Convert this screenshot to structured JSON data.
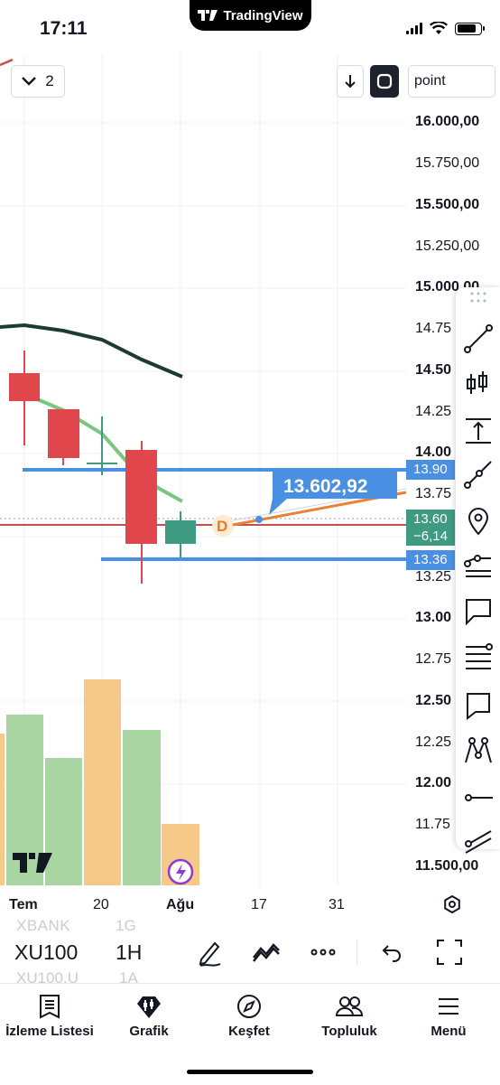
{
  "status": {
    "time": "17:11",
    "app_pill": "TradingView"
  },
  "chart_controls": {
    "collapse_count": "2",
    "unit_value": "point"
  },
  "price_axis": {
    "labels": [
      "16.000,00",
      "15.750,00",
      "15.500,00",
      "15.250,00",
      "15.000,00",
      "14.75",
      "14.50",
      "14.25",
      "14.00",
      "13.75",
      "13.25",
      "13.00",
      "12.75",
      "12.50",
      "12.25",
      "12.00",
      "11.75",
      "11.500,00"
    ],
    "tags": {
      "upper": "13.90",
      "current": "13.60",
      "change": "−6,14",
      "lower": "13.36"
    },
    "colors": {
      "upper": "#4a90e2",
      "current": "#3f9a82",
      "lower": "#4a90e2"
    }
  },
  "chart_overlay": {
    "price_callout": "13.602,92",
    "dividend_marker": "D",
    "candles": [
      {
        "open": 14.46,
        "high": 14.62,
        "low": 14.0,
        "close": 14.29,
        "direction": "down"
      },
      {
        "open": 14.26,
        "high": 14.26,
        "low": 13.95,
        "close": 13.98,
        "direction": "down"
      },
      {
        "open": 14.18,
        "high": 14.22,
        "low": 13.87,
        "close": 13.92,
        "direction": "neutral"
      },
      {
        "open": 14.02,
        "high": 14.07,
        "low": 13.21,
        "close": 13.45,
        "direction": "down"
      },
      {
        "open": 13.45,
        "high": 13.63,
        "low": 13.34,
        "close": 13.59,
        "direction": "up"
      }
    ],
    "volume_bars": [
      {
        "color": "orange"
      },
      {
        "color": "green"
      },
      {
        "color": "green"
      },
      {
        "color": "orange"
      },
      {
        "color": "green"
      },
      {
        "color": "orange"
      }
    ]
  },
  "time_axis": {
    "labels": [
      "Tem",
      "20",
      "Ağu",
      "17",
      "31"
    ]
  },
  "symbol_bar": {
    "symbol": "XU100",
    "interval": "1H",
    "ghost_above_symbol": "XBANK",
    "ghost_above_interval": "1G",
    "ghost_below_symbol": "XU100.U",
    "ghost_below_interval": "1A"
  },
  "bottom_nav": [
    {
      "label": "İzleme Listesi",
      "icon": "watchlist-icon"
    },
    {
      "label": "Grafik",
      "icon": "chart-icon"
    },
    {
      "label": "Keşfet",
      "icon": "compass-icon"
    },
    {
      "label": "Topluluk",
      "icon": "community-icon"
    },
    {
      "label": "Menü",
      "icon": "menu-icon"
    }
  ],
  "drawing_tools": [
    "drag-handle-icon",
    "trend-line-icon",
    "long-position-icon",
    "measure-icon",
    "ray-icon",
    "pin-icon",
    "parallel-channel-icon",
    "callout-icon",
    "fib-lines-icon",
    "comment-icon",
    "pattern-icon",
    "horizontal-ray-icon",
    "trend-angle-icon"
  ]
}
